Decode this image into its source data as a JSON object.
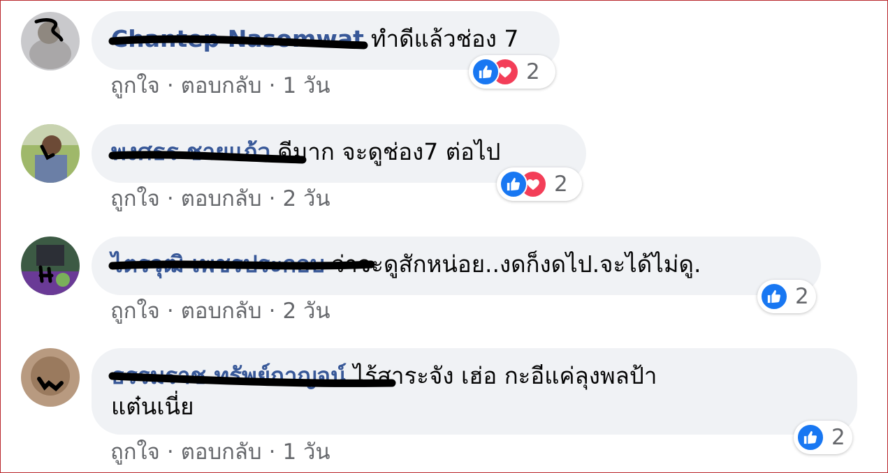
{
  "action_labels": {
    "like": "ถูกใจ",
    "reply": "ตอบกลับ",
    "separator": "·"
  },
  "comments": [
    {
      "author": "Chantep Nasomwat",
      "text": "ทำดีแล้วช่อง 7",
      "text_line2": "",
      "time": "1 วัน",
      "reactions": {
        "types": [
          "like-icon",
          "love-icon"
        ],
        "count": "2"
      }
    },
    {
      "author": "พงศธร ชายแก้ว",
      "text": "ดีมาก จะดูช่อง7 ต่อไป",
      "text_line2": "",
      "time": "2 วัน",
      "reactions": {
        "types": [
          "like-icon",
          "love-icon"
        ],
        "count": "2"
      }
    },
    {
      "author": "ไตรวุฒิ เพชรประกอบ",
      "text": "ว่าจะดูสักหน่อย..งดก็งดไป.จะได้ไม่ดู.",
      "text_line2": "",
      "time": "2 วัน",
      "reactions": {
        "types": [
          "like-icon"
        ],
        "count": "2"
      }
    },
    {
      "author": "ธรรมราช ทรัพย์กาญจน์",
      "text": "ไร้สาระจัง เฮ่อ กะอีแค่ลุงพลป้า",
      "text_line2": "แต๋นเนี่ย",
      "time": "1 วัน",
      "reactions": {
        "types": [
          "like-icon"
        ],
        "count": "2"
      }
    }
  ],
  "colors": {
    "author": "#385898",
    "bubble": "#f0f2f5",
    "like": "#1877f2",
    "love": "#f33e58",
    "meta": "#65676b"
  }
}
